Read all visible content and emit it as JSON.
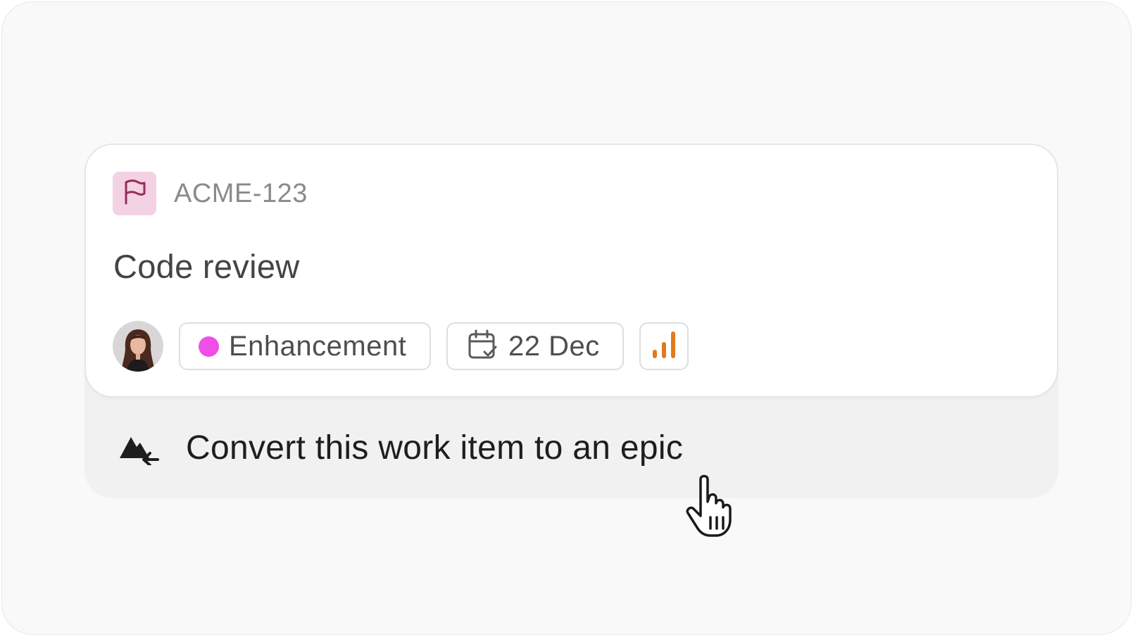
{
  "issue": {
    "key": "ACME-123",
    "title": "Code review",
    "type_icon": "flag-icon",
    "assignee_avatar": "avatar",
    "label": {
      "text": "Enhancement",
      "color": "#f04ee8"
    },
    "due_date": {
      "icon": "calendar-check-icon",
      "text": "22 Dec"
    },
    "priority": {
      "icon": "signal-bars-icon",
      "color": "#e07a1f"
    }
  },
  "action": {
    "icon": "mountain-convert-icon",
    "label": "Convert this work item to an epic"
  },
  "colors": {
    "type_icon_bg": "#f3d2e4",
    "type_icon_fg": "#9a2c5e",
    "card_bg": "#ffffff",
    "action_bg": "#f1f1f1"
  }
}
